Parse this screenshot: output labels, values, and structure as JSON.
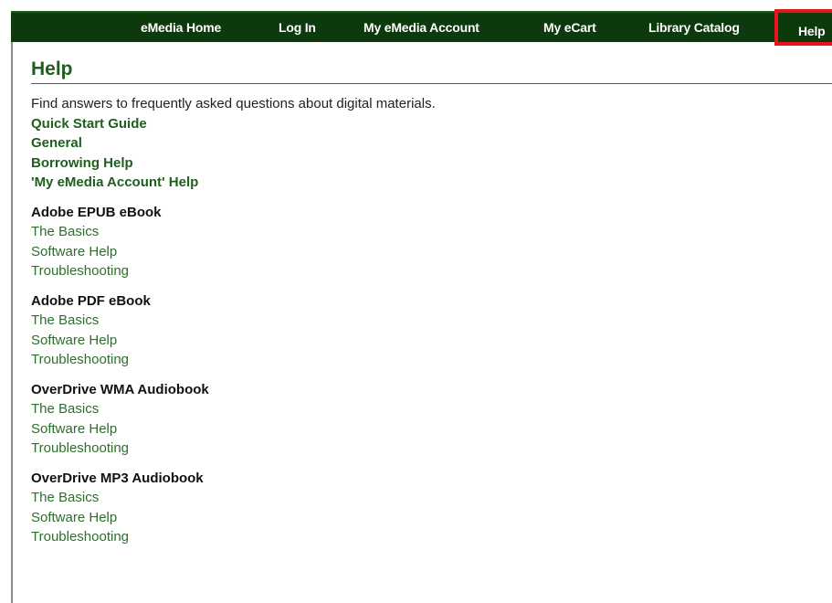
{
  "nav": {
    "home": "eMedia Home",
    "login": "Log In",
    "account": "My eMedia Account",
    "cart": "My eCart",
    "catalog": "Library Catalog",
    "help": "Help"
  },
  "page": {
    "title": "Help",
    "intro": "Find answers to frequently asked questions about digital materials."
  },
  "main_links": [
    "Quick Start Guide",
    "General",
    "Borrowing Help",
    "'My eMedia Account' Help"
  ],
  "sections": [
    {
      "title": "Adobe EPUB eBook",
      "links": [
        "The Basics",
        "Software Help",
        "Troubleshooting"
      ]
    },
    {
      "title": "Adobe PDF eBook",
      "links": [
        "The Basics",
        "Software Help",
        "Troubleshooting"
      ]
    },
    {
      "title": "OverDrive WMA Audiobook",
      "links": [
        "The Basics",
        "Software Help",
        "Troubleshooting"
      ]
    },
    {
      "title": "OverDrive MP3 Audiobook",
      "links": [
        "The Basics",
        "Software Help",
        "Troubleshooting"
      ]
    }
  ],
  "colors": {
    "nav_background": "#0c3a0c",
    "link_green": "#1e5e1e",
    "highlight_red": "#e8141c"
  }
}
